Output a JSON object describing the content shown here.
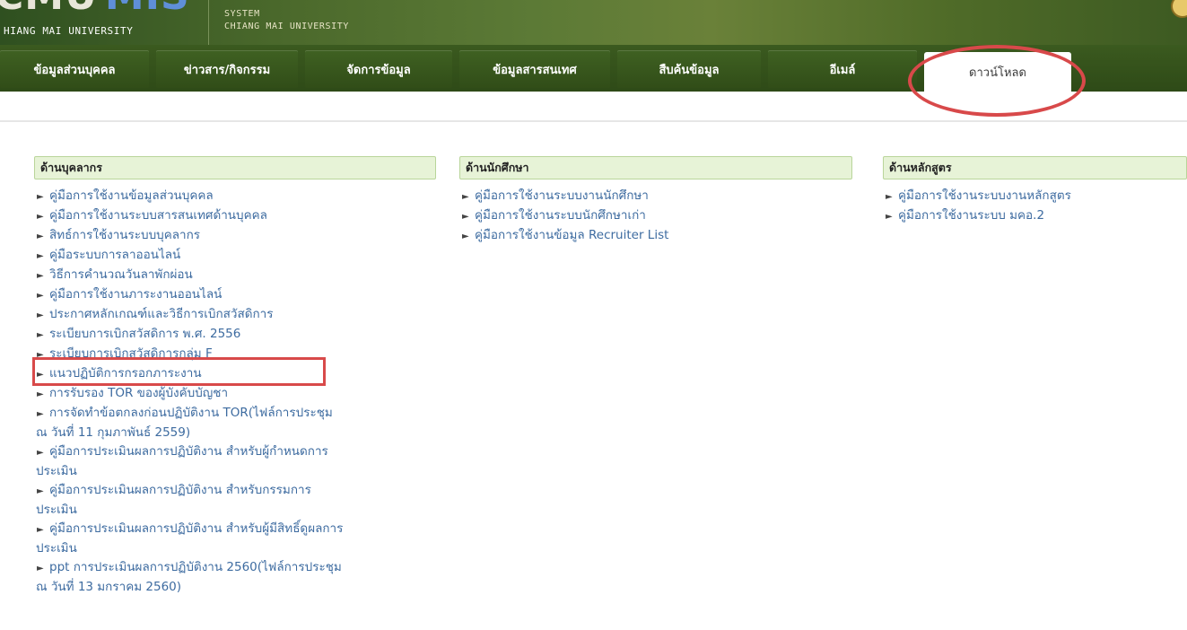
{
  "header": {
    "logo_cmu": "CMU",
    "logo_mis": "MIS",
    "university": "HIANG MAI UNIVERSITY",
    "system_line1": "SYSTEM",
    "system_line2": "CHIANG MAI UNIVERSITY"
  },
  "nav": {
    "tabs": [
      {
        "label": "ข้อมูลส่วนบุคคล"
      },
      {
        "label": "ข่าวสาร/กิจกรรม"
      },
      {
        "label": "จัดการข้อมูล"
      },
      {
        "label": "ข้อมูลสารสนเทศ"
      },
      {
        "label": "สืบค้นข้อมูล"
      },
      {
        "label": "อีเมล์"
      },
      {
        "label": "ดาวน์โหลด"
      }
    ]
  },
  "columns": {
    "personnel": {
      "title": "ด้านบุคลากร",
      "items": [
        "คู่มือการใช้งานข้อมูลส่วนบุคคล",
        "คู่มือการใช้งานระบบสารสนเทศด้านบุคคล",
        "สิทธ์การใช้งานระบบบุคลากร",
        "คู่มือระบบการลาออนไลน์",
        "วิธีการคำนวณวันลาพักผ่อน",
        "คู่มือการใช้งานภาระงานออนไลน์",
        "ประกาศหลักเกณฑ์และวิธีการเบิกสวัสดิการ",
        "ระเบียบการเบิกสวัสดิการ พ.ศ. 2556",
        "ระเบียบการเบิกสวัสดิการกลุ่ม F",
        "แนวปฏิบัติการกรอกภาระงาน",
        "การรับรอง TOR ของผู้บังคับบัญชา"
      ],
      "wrapped_items": [
        {
          "line1": "การจัดทำข้อตกลงก่อนปฏิบัติงาน TOR(ไฟล์การประชุม",
          "line2": "ณ วันที่ 11 กุมภาพันธ์ 2559)"
        },
        {
          "line1": "คู่มือการประเมินผลการปฏิบัติงาน สำหรับผู้กำหนดการ",
          "line2": "ประเมิน"
        },
        {
          "line1": "คู่มือการประเมินผลการปฏิบัติงาน สำหรับกรรมการ",
          "line2": "ประเมิน"
        },
        {
          "line1": "คู่มือการประเมินผลการปฏิบัติงาน สำหรับผู้มีสิทธิ์ดูผลการ",
          "line2": "ประเมิน"
        },
        {
          "line1": "ppt การประเมินผลการปฏิบัติงาน 2560(ไฟล์การประชุม",
          "line2": "ณ วันที่ 13 มกราคม 2560)"
        }
      ]
    },
    "students": {
      "title": "ด้านนักศึกษา",
      "items": [
        "คู่มือการใช้งานระบบงานนักศึกษา",
        "คู่มือการใช้งานระบบนักศึกษาเก่า",
        "คู่มือการใช้งานข้อมูล Recruiter List"
      ]
    },
    "curriculum": {
      "title": "ด้านหลักสูตร",
      "items": [
        "คู่มือการใช้งานระบบงานหลักสูตร",
        "คู่มือการใช้งานระบบ มคอ.2"
      ]
    }
  },
  "colors": {
    "link": "#3d6ba0",
    "header_green": "#4c6a2c",
    "annotation_red": "#d84a4a"
  }
}
